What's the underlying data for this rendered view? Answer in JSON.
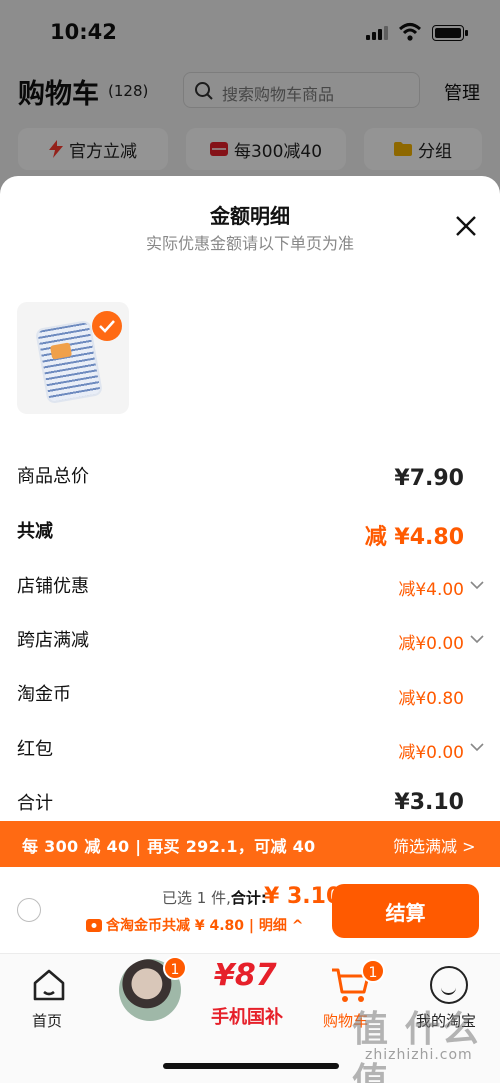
{
  "status_bar": {
    "time": "10:42"
  },
  "background": {
    "title": "购物车",
    "count": "(128)",
    "search_placeholder": "搜索购物车商品",
    "manage": "管理",
    "chips": [
      "官方立减",
      "每300减40",
      "分组"
    ]
  },
  "sheet": {
    "title": "金额明细",
    "subtitle": "实际优惠金额请以下单页为准",
    "rows": [
      {
        "label": "商品总价",
        "value": "¥7.90"
      },
      {
        "label": "共减",
        "value": "减 ¥4.80"
      },
      {
        "label": "店铺优惠",
        "value": "减¥4.00"
      },
      {
        "label": "跨店满减",
        "value": "减¥0.00"
      },
      {
        "label": "淘金币",
        "value": "减¥0.80"
      },
      {
        "label": "红包",
        "value": "减¥0.00"
      },
      {
        "label": "合计",
        "value": "¥3.10"
      }
    ]
  },
  "promo": {
    "left": "每 300 减 40 | 再买 292.1，可减 40",
    "right": "筛选满减 >"
  },
  "checkout": {
    "selected": "已选 1 件,",
    "total_label": "合计:",
    "total": "¥ 3.10",
    "gold_note": "含淘金币共减 ¥ 4.80 | 明细 ^",
    "pay_button": "结算"
  },
  "tabbar": {
    "home": "首页",
    "avatar_badge": "1",
    "promo_num": "¥87",
    "promo_text": "手机国补",
    "cart": "购物车",
    "cart_badge": "1",
    "me": "我的淘宝"
  },
  "watermark": {
    "big": "值 什么值",
    "small": "zhizhizhi.com"
  },
  "colors": {
    "accent": "#ff5a00",
    "promo_bg": "#ff6a13",
    "red": "#e6202a"
  }
}
